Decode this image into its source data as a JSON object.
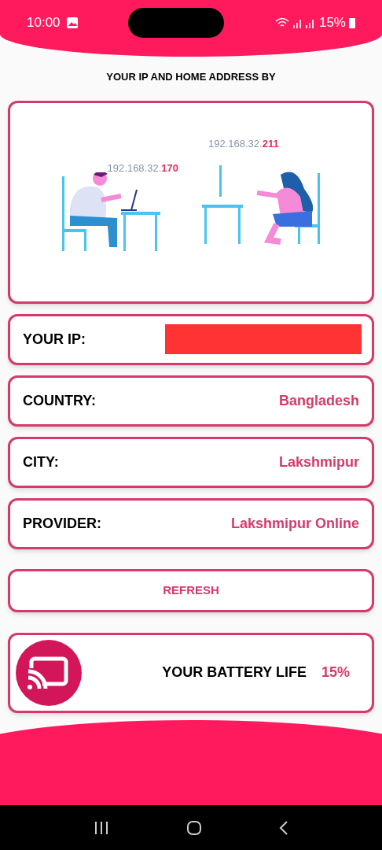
{
  "status_bar": {
    "time": "10:00",
    "battery": "15%"
  },
  "title": "YOUR IP AND HOME ADDRESS BY",
  "illustration": {
    "left_ip": "192.168.32.",
    "left_ip_end": "170",
    "right_ip": "192.168.32.",
    "right_ip_end": "211"
  },
  "info_rows": [
    {
      "label": "YOUR IP:",
      "redacted": true
    },
    {
      "label": "COUNTRY:",
      "value": "Bangladesh",
      "redacted": false
    },
    {
      "label": "CITY:",
      "value": "Lakshmipur",
      "redacted": false
    },
    {
      "label": "PROVIDER:",
      "value": "Lakshmipur Online",
      "redacted": false
    }
  ],
  "refresh_button": "REFRESH",
  "battery_card": {
    "label": "YOUR BATTERY LIFE",
    "value": "15%"
  }
}
